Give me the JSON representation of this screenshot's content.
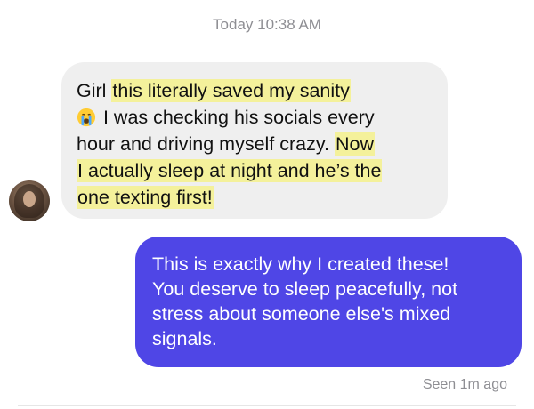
{
  "thread": {
    "timestamp": "Today 10:38 AM",
    "incoming": {
      "lines": [
        {
          "plain_a": "Girl ",
          "highlight": "this literally saved my sanity",
          "plain_b": ""
        },
        {
          "emoji": "crying-face-emoji",
          "plain_a": " I was checking his socials every",
          "highlight": "",
          "plain_b": ""
        },
        {
          "plain_a": "hour and driving myself crazy. ",
          "highlight": "Now",
          "plain_b": ""
        },
        {
          "plain_a": "",
          "highlight": "I actually sleep at night and he’s the",
          "plain_b": ""
        },
        {
          "plain_a": "",
          "highlight": "one texting first!",
          "plain_b": ""
        }
      ]
    },
    "outgoing": {
      "lines": [
        "This is exactly why I created these!",
        "You deserve to sleep peacefully, not",
        "stress about someone else's mixed",
        "signals."
      ]
    },
    "receipt": "Seen 1m ago"
  },
  "colors": {
    "incoming_bubble": "#efefef",
    "outgoing_bubble": "#4f46e6",
    "highlight": "#f4f19b",
    "meta_text": "#8e8e93"
  }
}
